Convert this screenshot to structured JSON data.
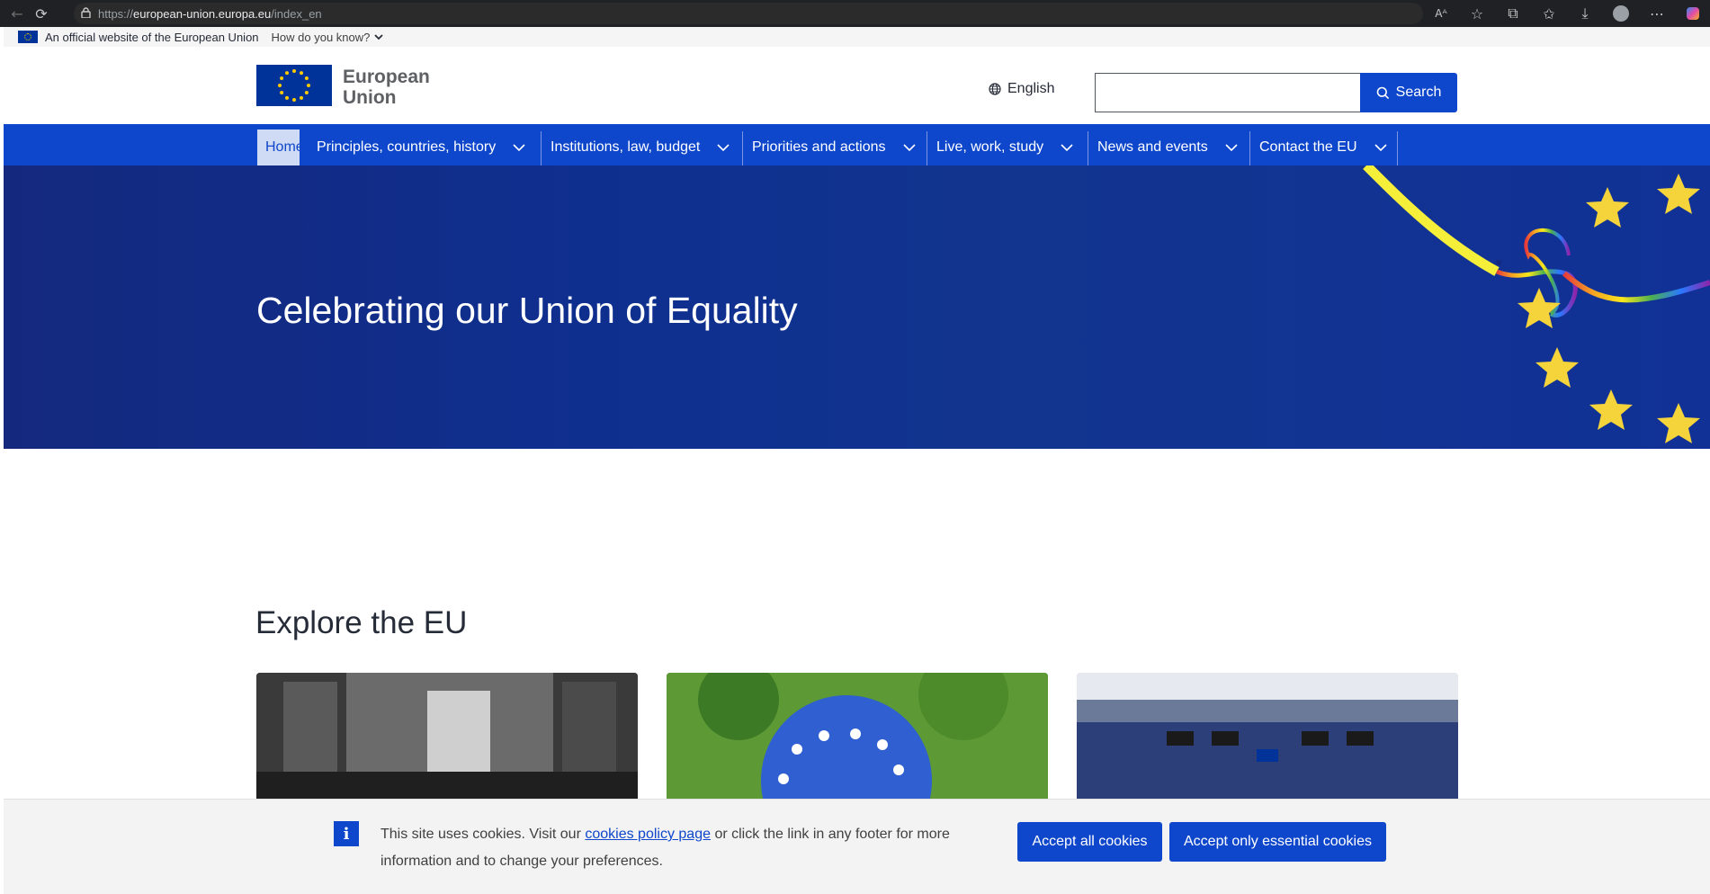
{
  "browser": {
    "url_protocol": "https://",
    "url_domain": "european-union.europa.eu",
    "url_path": "/index_en"
  },
  "official_banner": {
    "text": "An official website of the European Union",
    "how_know": "How do you know?"
  },
  "header": {
    "logo_line1": "European",
    "logo_line2": "Union",
    "language": "English",
    "search_placeholder": "",
    "search_label": "Search"
  },
  "nav": {
    "items": [
      {
        "label": "Home"
      },
      {
        "label": "Principles, countries, history"
      },
      {
        "label": "Institutions, law, budget"
      },
      {
        "label": "Priorities and actions"
      },
      {
        "label": "Live, work, study"
      },
      {
        "label": "News and events"
      },
      {
        "label": "Contact the EU"
      }
    ]
  },
  "hero": {
    "title": "Celebrating our Union of Equality"
  },
  "explore": {
    "title": "Explore the EU"
  },
  "cookie": {
    "text_before": "This site uses cookies. Visit our ",
    "link": "cookies policy page",
    "text_after": " or click the link in any footer for more information and to change your preferences.",
    "accept_all": "Accept all cookies",
    "accept_essential": "Accept only essential cookies"
  },
  "colors": {
    "brand_blue": "#0e47cb",
    "eu_blue": "#003399",
    "eu_yellow": "#ffcc00"
  }
}
